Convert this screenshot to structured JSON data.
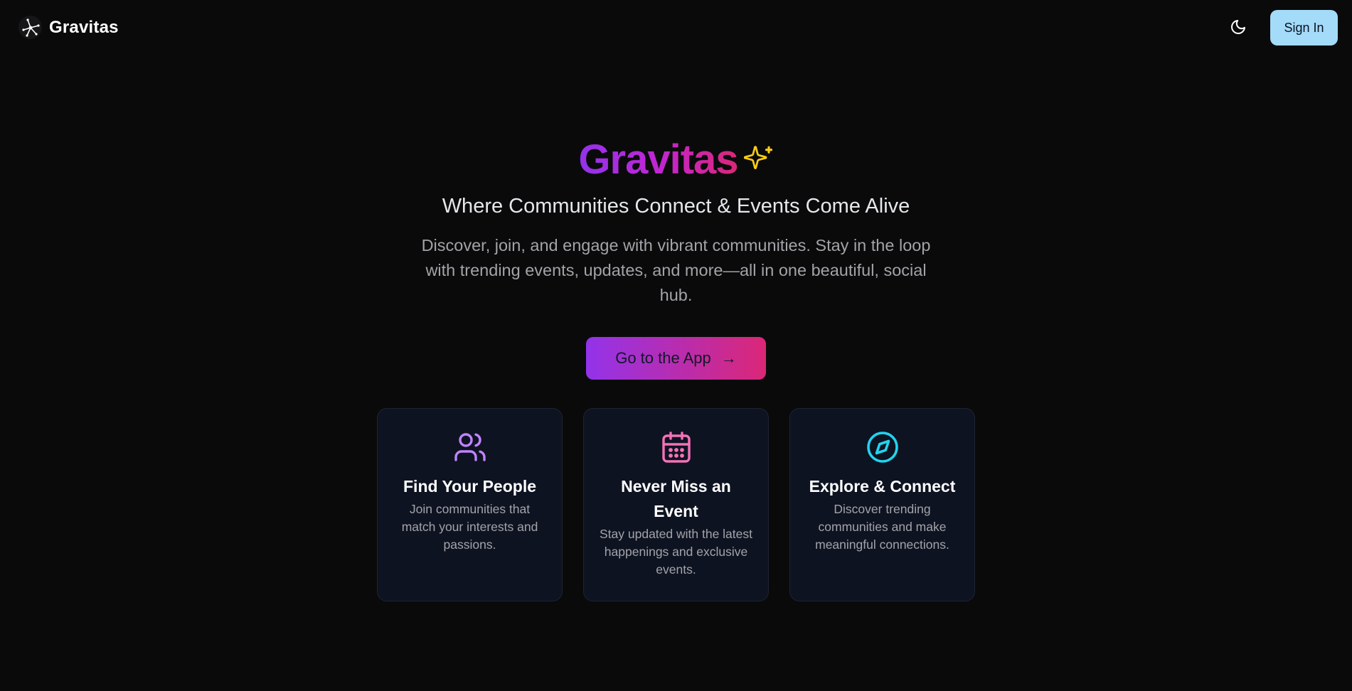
{
  "header": {
    "brand_name": "Gravitas",
    "signin_label": "Sign In"
  },
  "hero": {
    "title": "Gravitas",
    "subtitle": "Where Communities Connect & Events Come Alive",
    "description": "Discover, join, and engage with vibrant communities. Stay in the loop with trending events, updates, and more—all in one beautiful, social hub.",
    "cta_label": "Go to the App",
    "cta_arrow": "→"
  },
  "features": [
    {
      "icon": "users-icon",
      "title": "Find Your People",
      "text": "Join communities that match your interests and passions."
    },
    {
      "icon": "calendar-icon",
      "title": "Never Miss an Event",
      "text": "Stay updated with the latest happenings and exclusive events."
    },
    {
      "icon": "compass-icon",
      "title": "Explore & Connect",
      "text": "Discover trending communities and make meaningful connections."
    }
  ],
  "colors": {
    "background": "#0a0a0b",
    "brand_gradient_start": "#9333ea",
    "brand_gradient_end": "#db2777",
    "sparkle": "#facc15",
    "signin_bg": "#a3dbf9",
    "card_bg": "#0e1322",
    "users_icon": "#c084fc",
    "calendar_icon": "#f472b6",
    "compass_icon": "#22d3ee"
  }
}
